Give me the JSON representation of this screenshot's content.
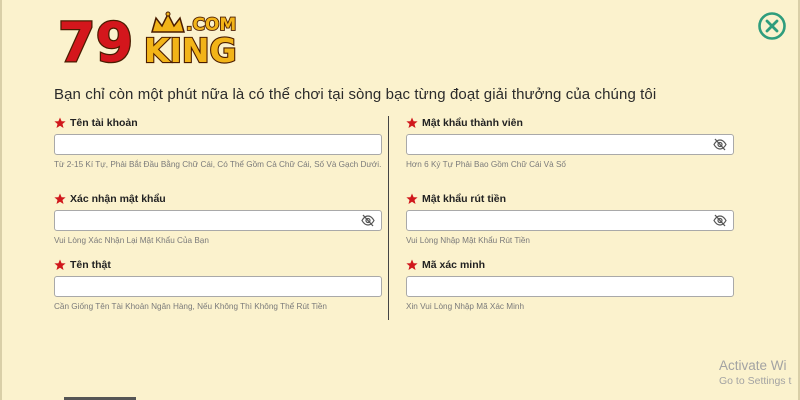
{
  "brand": {
    "logo_number": "79",
    "logo_word": "KING",
    "logo_domain": ".COM",
    "colors": {
      "number_red": "#d4161c",
      "gold": "#f2b418",
      "outline": "#4a1c00"
    }
  },
  "close_button": {
    "icon": "close-circle-icon",
    "color": "#2f9d7d"
  },
  "headline": "Bạn chỉ còn một phút nữa là có thể chơi tại sòng bạc từng đoạt giải thưởng của chúng tôi",
  "form": {
    "left": [
      {
        "label": "Tên tài khoản",
        "value": "",
        "hint": "Từ 2-15 Kí Tự, Phải Bắt Đầu Bằng Chữ Cái, Có Thể Gồm Cả Chữ Cái, Số Và Gạch Dưới.",
        "password": false
      },
      {
        "label": "Xác nhận mật khẩu",
        "value": "",
        "hint": "Vui Lòng Xác Nhận Lại Mật Khẩu Của Bạn",
        "password": true
      },
      {
        "label": "Tên thật",
        "value": "",
        "hint": "Cần Giống Tên Tài Khoản Ngân Hàng, Nếu Không Thì Không Thể Rút Tiền",
        "password": false
      }
    ],
    "right": [
      {
        "label": "Mật khẩu thành viên",
        "value": "",
        "hint": "Hơn 6 Ký Tự Phải Bao Gồm Chữ Cái Và Số",
        "password": true
      },
      {
        "label": "Mật khẩu rút tiền",
        "value": "",
        "hint": "Vui Lòng Nhập Mật Khẩu Rút Tiền",
        "password": true
      },
      {
        "label": "Mã xác minh",
        "value": "",
        "hint": "Xin Vui Lòng Nhập Mã Xác Minh",
        "password": false
      }
    ],
    "required_icon": "star-icon",
    "required_color": "#d0181c",
    "toggle_icon": "eye-slash-icon"
  },
  "watermark": {
    "title": "Activate Wi",
    "subtitle": "Go to Settings t"
  }
}
